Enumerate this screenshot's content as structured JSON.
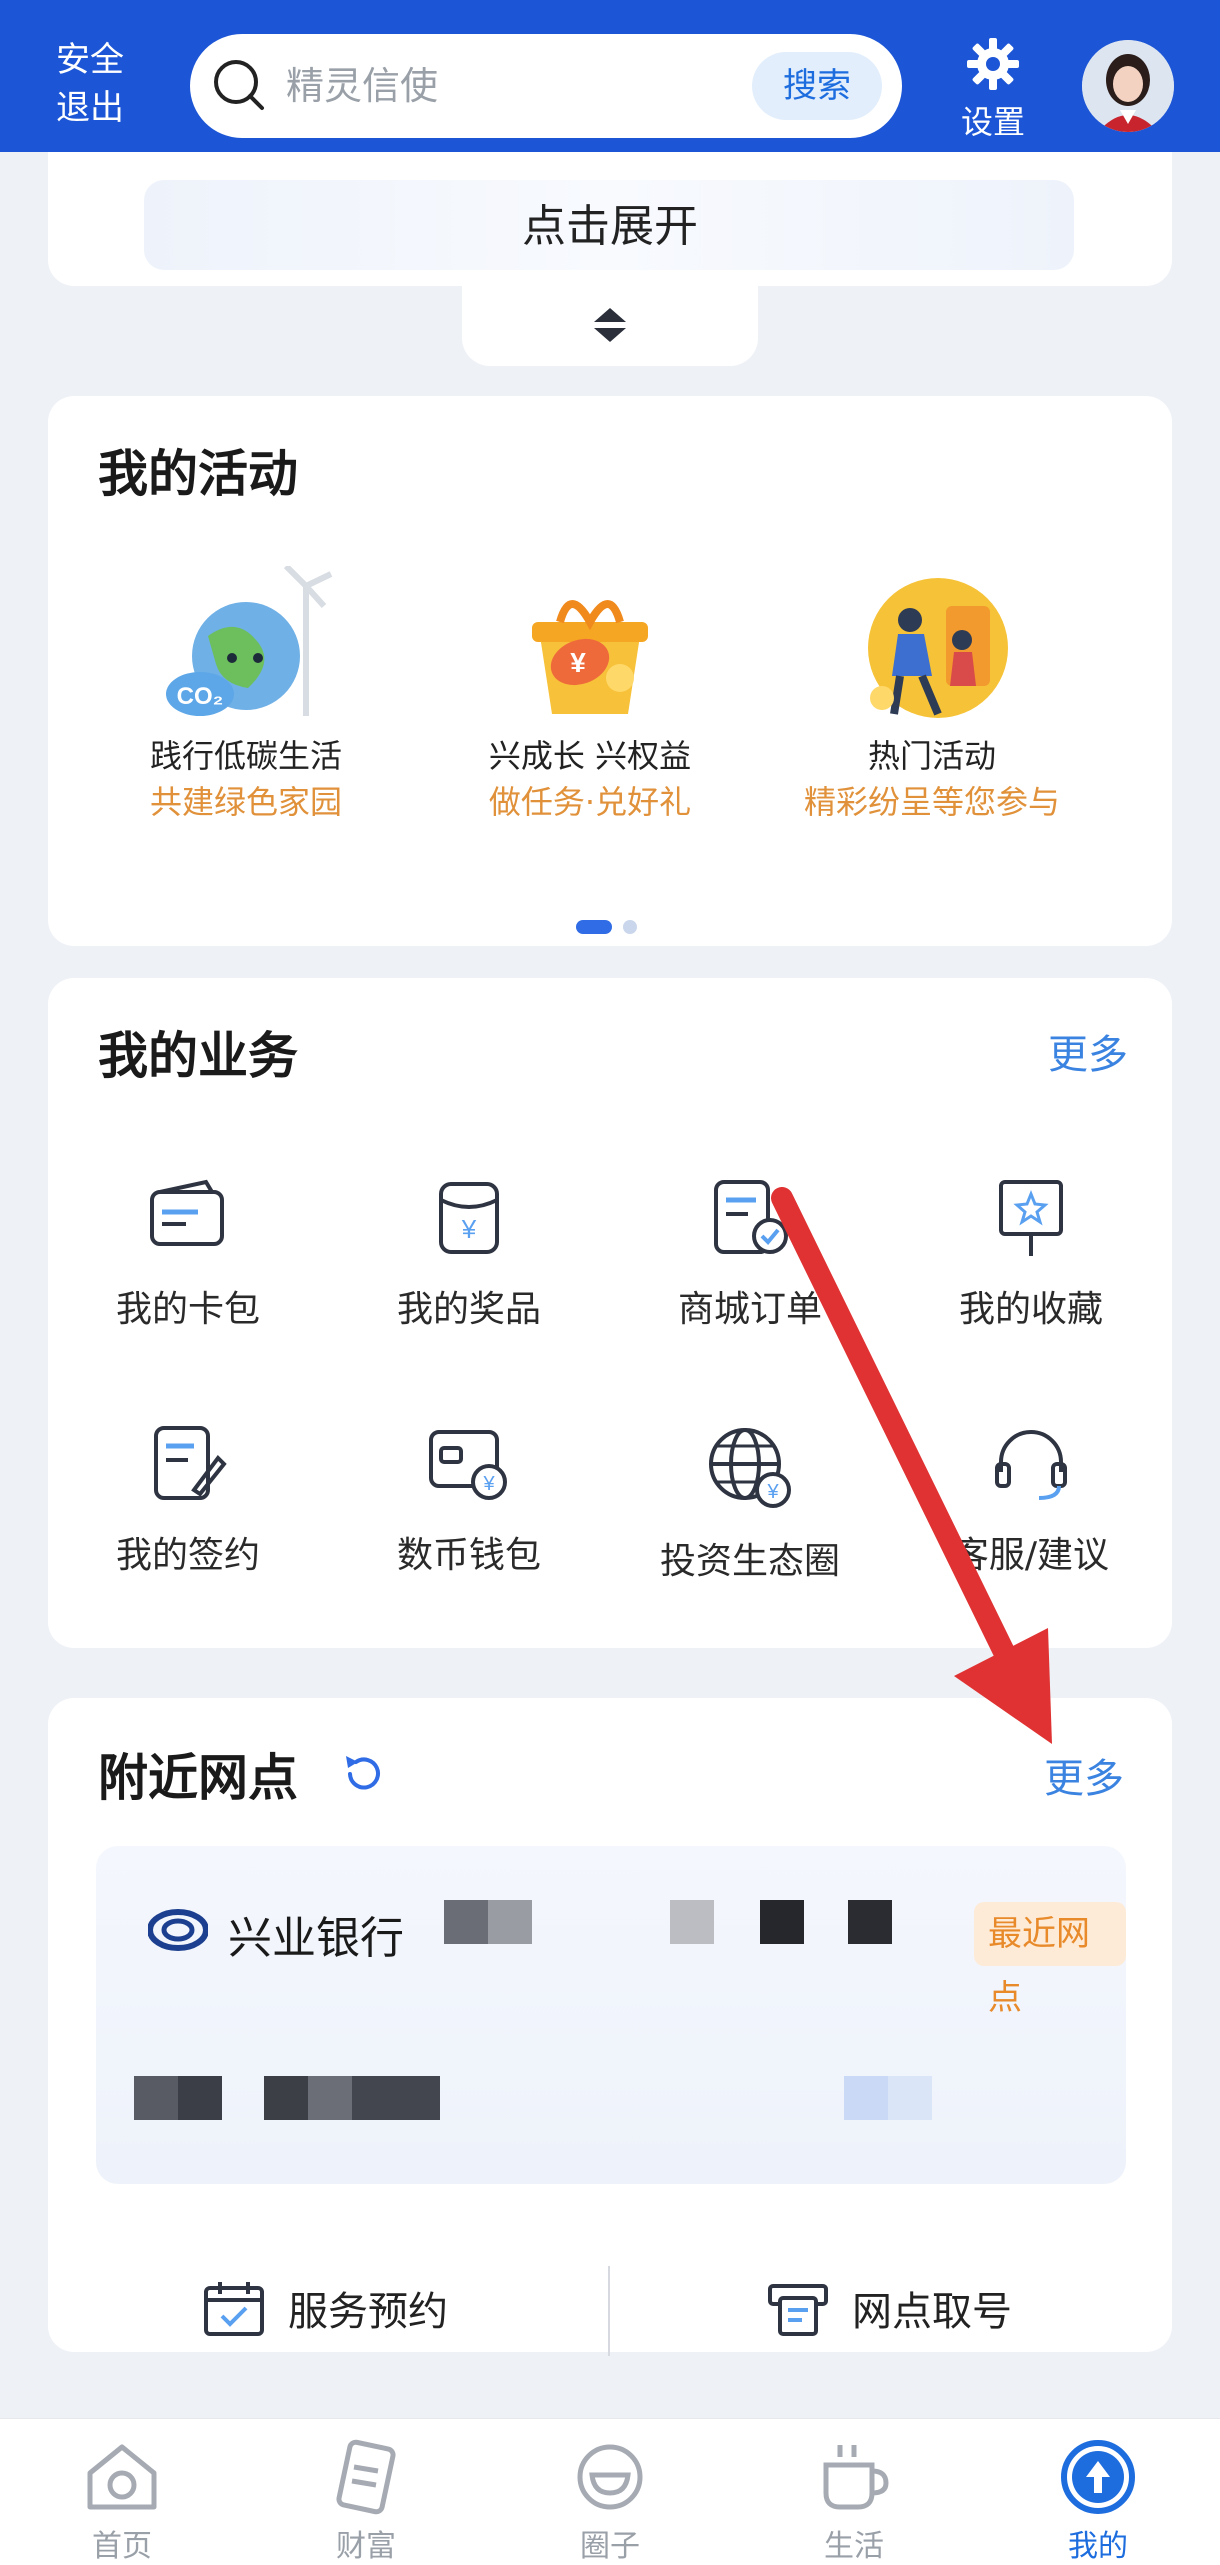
{
  "header": {
    "exit_label": "安全\n退出",
    "exit_line1": "安全",
    "exit_line2": "退出",
    "search_placeholder": "精灵信使",
    "search_button": "搜索",
    "settings_label": "设置",
    "brand_color": "#1c56d6"
  },
  "expand": {
    "label": "点击展开"
  },
  "activities": {
    "title": "我的活动",
    "items": [
      {
        "line1": "践行低碳生活",
        "line2": "共建绿色家园",
        "icon": "earth-co2-icon"
      },
      {
        "line1": "兴成长 兴权益",
        "line2": "做任务·兑好礼",
        "icon": "gift-box-icon"
      },
      {
        "line1": "热门活动",
        "line2": "精彩纷呈等您参与",
        "icon": "people-activity-icon"
      }
    ]
  },
  "business": {
    "title": "我的业务",
    "more": "更多",
    "items": [
      {
        "label": "我的卡包",
        "icon": "card-wallet-icon"
      },
      {
        "label": "我的奖品",
        "icon": "prize-icon"
      },
      {
        "label": "商城订单",
        "icon": "order-icon"
      },
      {
        "label": "我的收藏",
        "icon": "favorite-icon"
      },
      {
        "label": "我的签约",
        "icon": "contract-icon"
      },
      {
        "label": "数币钱包",
        "icon": "digital-wallet-icon"
      },
      {
        "label": "投资生态圈",
        "icon": "globe-invest-icon"
      },
      {
        "label": "客服/建议",
        "icon": "headset-icon"
      }
    ]
  },
  "nearby": {
    "title": "附近网点",
    "more": "更多",
    "branch_name": "兴业银行",
    "branch_tag": "最近网点",
    "actions": [
      {
        "label": "服务预约",
        "icon": "calendar-check-icon"
      },
      {
        "label": "网点取号",
        "icon": "ticket-printer-icon"
      }
    ]
  },
  "bottom_nav": [
    {
      "label": "首页",
      "icon": "home-icon",
      "active": false
    },
    {
      "label": "财富",
      "icon": "wealth-icon",
      "active": false
    },
    {
      "label": "圈子",
      "icon": "circle-icon",
      "active": false
    },
    {
      "label": "生活",
      "icon": "coffee-icon",
      "active": false
    },
    {
      "label": "我的",
      "icon": "me-icon",
      "active": true
    }
  ],
  "accent_color": "#3a83e0",
  "annotation_color": "#e03232"
}
